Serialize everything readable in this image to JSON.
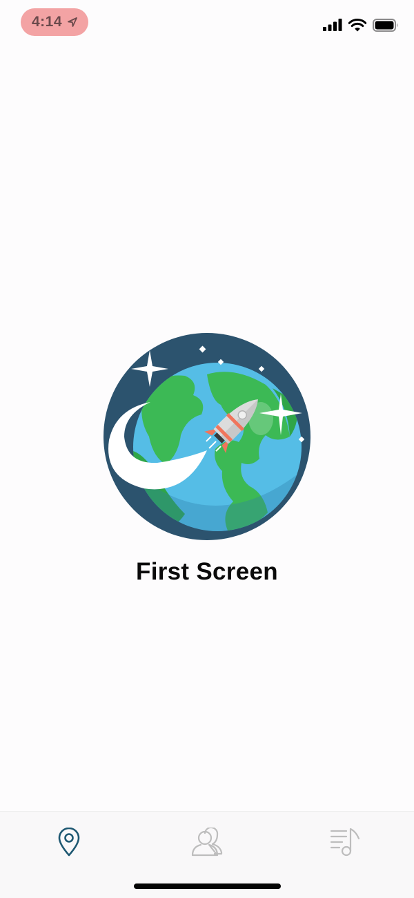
{
  "status_bar": {
    "time": "4:14",
    "icons": [
      "location-arrow-icon",
      "cellular-signal-icon",
      "wifi-icon",
      "battery-icon"
    ]
  },
  "main": {
    "title": "First Screen",
    "illustration": "earth-rocket-illustration"
  },
  "tab_bar": {
    "tabs": [
      {
        "icon": "map-pin-icon",
        "active": true
      },
      {
        "icon": "users-icon",
        "active": false
      },
      {
        "icon": "music-playlist-icon",
        "active": false
      }
    ]
  },
  "colors": {
    "background": "#fdfcfd",
    "accent": "#1e5872",
    "inactive_icon": "#bdbdbd",
    "time_pill": "#f3a3a4",
    "space": "#2c536e",
    "ocean": "#55bde6",
    "land": "#3cb955",
    "rocket_fin": "#f0755c"
  }
}
